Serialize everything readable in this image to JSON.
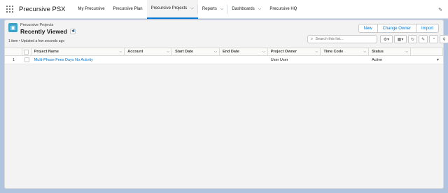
{
  "app": {
    "name": "Precursive PSX"
  },
  "nav": {
    "items": [
      {
        "label": "My Precursive",
        "active": false,
        "has_dropdown": false
      },
      {
        "label": "Precursive Plan",
        "active": false,
        "has_dropdown": false
      },
      {
        "label": "Precursive Projects",
        "active": true,
        "has_dropdown": true
      },
      {
        "label": "Reports",
        "active": false,
        "has_dropdown": true
      },
      {
        "label": "Dashboards",
        "active": false,
        "has_dropdown": true
      },
      {
        "label": "Precursive HQ",
        "active": false,
        "has_dropdown": false
      }
    ]
  },
  "list_view": {
    "object_label": "Precursive Projects",
    "title": "Recently Viewed",
    "status": "1 item • Updated a few seconds ago",
    "buttons": {
      "new": "New",
      "change_owner": "Change Owner",
      "import": "Import"
    },
    "search": {
      "placeholder": "Search this list...",
      "value": ""
    },
    "columns": [
      "Project Name",
      "Account",
      "Start Date",
      "End Date",
      "Project Owner",
      "Time Code",
      "Status"
    ],
    "rows": [
      {
        "num": "1",
        "project_name": "Multi-Phase Fees Days No Activity",
        "account": "",
        "start_date": "",
        "end_date": "",
        "project_owner": "User User",
        "time_code": "",
        "status": "Active"
      }
    ]
  },
  "colors": {
    "accent": "#0176d3",
    "background": "#b0c4df",
    "object_icon": "#3ba1c9"
  }
}
